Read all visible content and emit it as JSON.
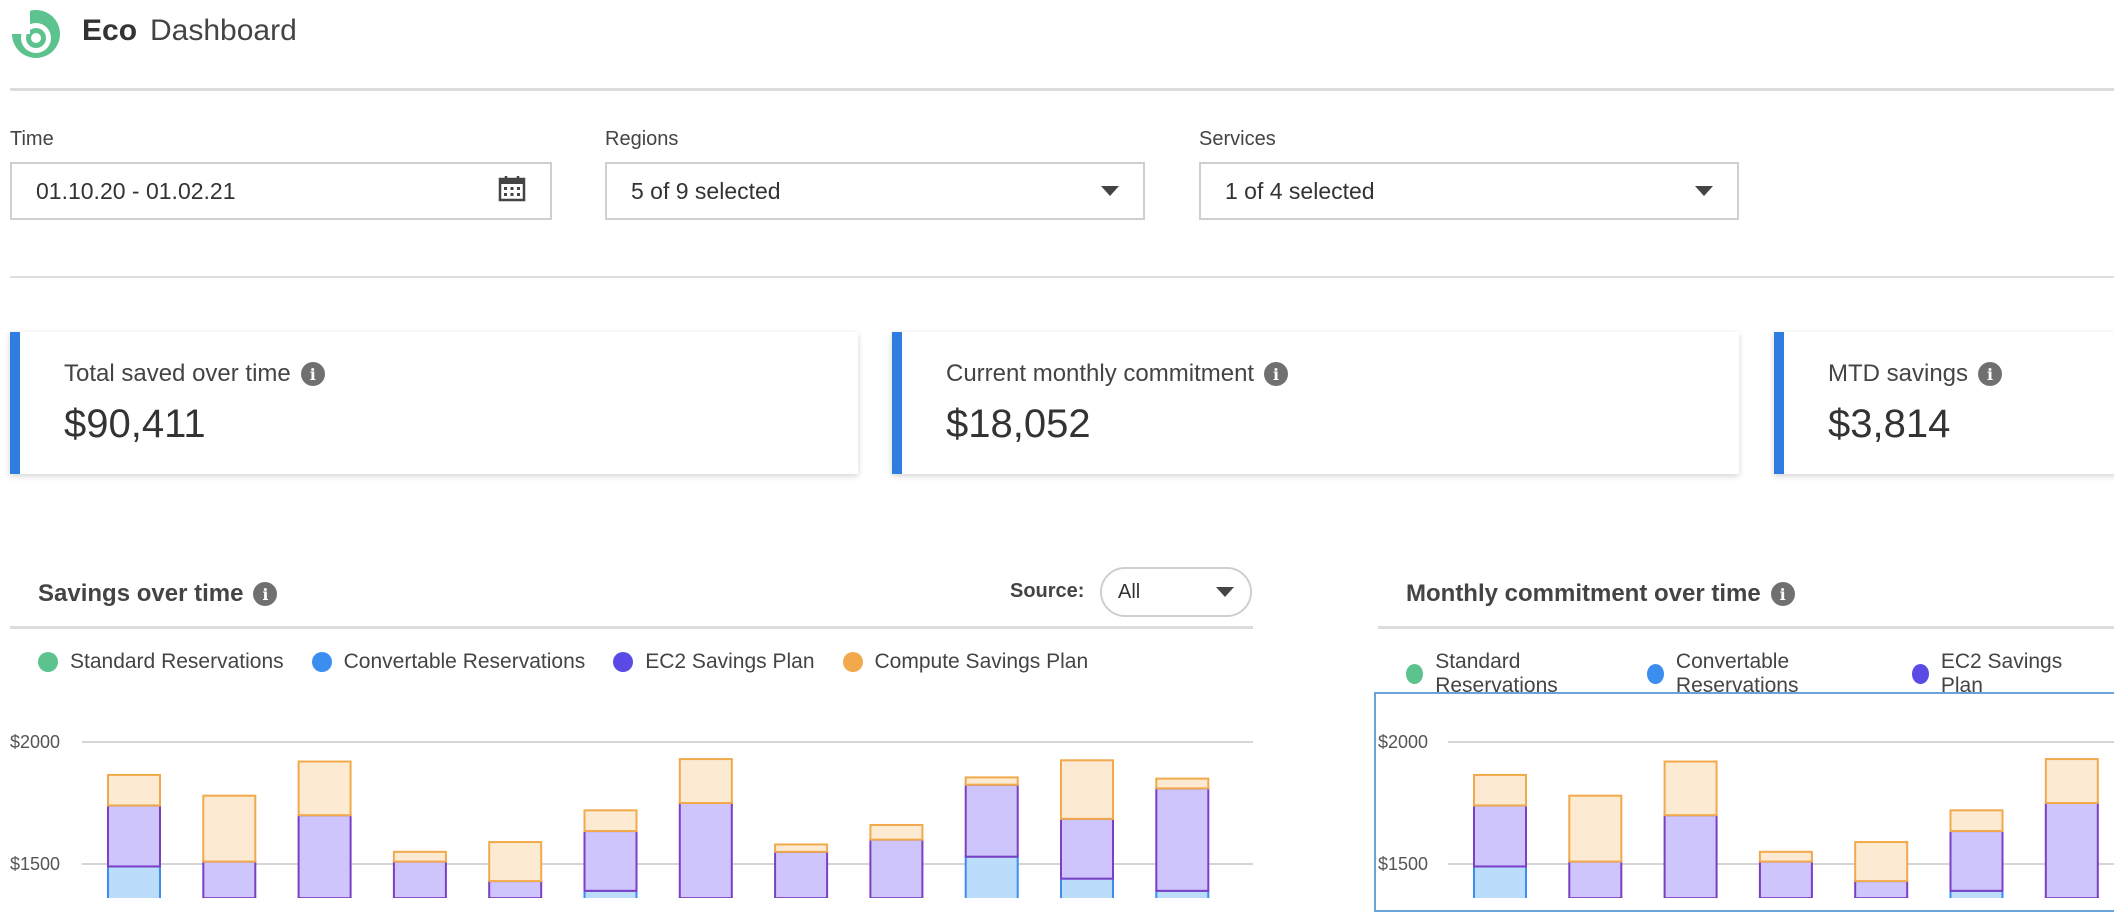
{
  "header": {
    "brand": "Eco",
    "title": "Dashboard"
  },
  "filters": {
    "time": {
      "label": "Time",
      "value": "01.10.20 - 01.02.21"
    },
    "regions": {
      "label": "Regions",
      "value": "5 of 9 selected"
    },
    "services": {
      "label": "Services",
      "value": "1 of 4 selected"
    }
  },
  "cards": [
    {
      "title": "Total saved over time",
      "value": "$90,411"
    },
    {
      "title": "Current monthly commitment",
      "value": "$18,052"
    },
    {
      "title": "MTD savings",
      "value": "$3,814"
    }
  ],
  "colors": {
    "accent": "#2f7de1",
    "standard": "#5cc28e",
    "convertable": "#3b8ef0",
    "ec2": "#5a4be6",
    "compute": "#f2a94b"
  },
  "panels": {
    "savings": {
      "title": "Savings over time",
      "source_label": "Source:",
      "source_value": "All",
      "legend": [
        "Standard Reservations",
        "Convertable Reservations",
        "EC2 Savings Plan",
        "Compute Savings Plan"
      ]
    },
    "commitment": {
      "title": "Monthly commitment over time",
      "legend": [
        "Standard Reservations",
        "Convertable Reservations",
        "EC2 Savings Plan"
      ]
    }
  },
  "chart_data": [
    {
      "type": "bar",
      "stacked": true,
      "y_tick_labels": [
        "$2000",
        "$1500"
      ],
      "y_ticks": [
        2000,
        1500
      ],
      "ylim_visible": [
        1360,
        2090
      ],
      "series": [
        {
          "name": "Convertable Reservations",
          "values": [
            1490,
            1360,
            1360,
            1360,
            1360,
            1390,
            1360,
            1360,
            1360,
            1530,
            1440,
            1390
          ]
        },
        {
          "name": "EC2 Savings Plan",
          "values": [
            250,
            150,
            340,
            150,
            70,
            245,
            390,
            190,
            240,
            295,
            245,
            420
          ]
        },
        {
          "name": "Compute Savings Plan",
          "values": [
            125,
            270,
            220,
            40,
            160,
            85,
            180,
            30,
            60,
            30,
            240,
            40
          ]
        }
      ]
    },
    {
      "type": "bar",
      "stacked": true,
      "y_tick_labels": [
        "$2000",
        "$1500"
      ],
      "y_ticks": [
        2000,
        1500
      ],
      "ylim_visible": [
        1360,
        2090
      ],
      "series": [
        {
          "name": "Convertable Reservations",
          "values": [
            1490,
            1360,
            1360,
            1360,
            1360,
            1390,
            1360
          ]
        },
        {
          "name": "EC2 Savings Plan",
          "values": [
            250,
            150,
            340,
            150,
            70,
            245,
            390
          ]
        },
        {
          "name": "Compute Savings Plan",
          "values": [
            125,
            270,
            220,
            40,
            160,
            85,
            180
          ]
        }
      ]
    }
  ]
}
